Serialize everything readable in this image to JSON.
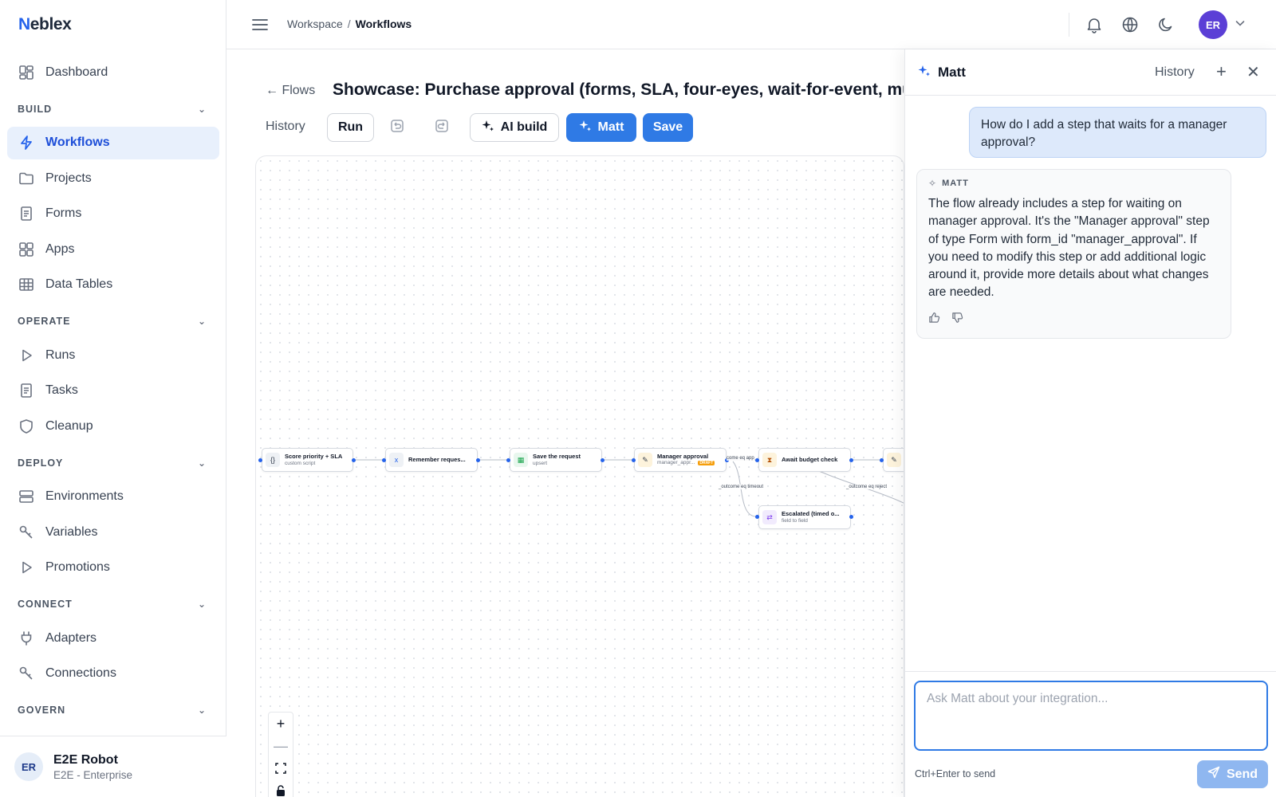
{
  "app": {
    "logo_first": "N",
    "logo_rest": "eblex"
  },
  "sidebar": {
    "dashboard": "Dashboard",
    "sections": [
      {
        "title": "BUILD",
        "items": [
          "Workflows",
          "Projects",
          "Forms",
          "Apps",
          "Data Tables"
        ]
      },
      {
        "title": "OPERATE",
        "items": [
          "Runs",
          "Tasks",
          "Cleanup"
        ]
      },
      {
        "title": "DEPLOY",
        "items": [
          "Environments",
          "Variables",
          "Promotions"
        ]
      },
      {
        "title": "CONNECT",
        "items": [
          "Adapters",
          "Connections"
        ]
      },
      {
        "title": "GOVERN",
        "items": []
      }
    ],
    "active": "Workflows",
    "user": {
      "initials": "ER",
      "name": "E2E Robot",
      "org": "E2E - Enterprise"
    }
  },
  "topbar": {
    "breadcrumb": [
      "Workspace",
      "Workflows"
    ],
    "avatar_initials": "ER",
    "accent": "#5b3fd6"
  },
  "flow": {
    "back_label": "Flows",
    "title": "Showcase: Purchase approval (forms, SLA, four-eyes, wait-for-event, multi-p",
    "toolbar": {
      "history": "History",
      "run": "Run",
      "ai_build": "AI build",
      "matt": "Matt",
      "save": "Save"
    },
    "nodes": [
      {
        "title": "Score priority + SLA",
        "sub": "custom script",
        "icon": "{}"
      },
      {
        "title": "Remember reques...",
        "sub": "",
        "icon": "x"
      },
      {
        "title": "Save the request",
        "sub": "upsert",
        "icon": "▦"
      },
      {
        "title": "Manager approval",
        "sub": "manager_appr...",
        "badge": "DRAFT",
        "icon": "✎"
      },
      {
        "title": "Await budget check",
        "sub": "",
        "icon": "⧗"
      },
      {
        "title": "Escalated (timed o...",
        "sub": "field to field",
        "icon": "⇄"
      }
    ],
    "edge_labels": [
      "come eq app",
      "_outcome eq timeout",
      "_outcome eq reject"
    ]
  },
  "chat": {
    "name": "Matt",
    "history": "History",
    "user_message": "How do I add a step that waits for a manager approval?",
    "ai_label": "MATT",
    "ai_message": "The flow already includes a step for waiting on manager approval. It's the \"Manager approval\" step of type Form with form_id \"manager_approval\". If you need to modify this step or add additional logic around it, provide more details about what changes are needed.",
    "input_placeholder": "Ask Matt about your integration...",
    "hint": "Ctrl+Enter to send",
    "send": "Send"
  }
}
